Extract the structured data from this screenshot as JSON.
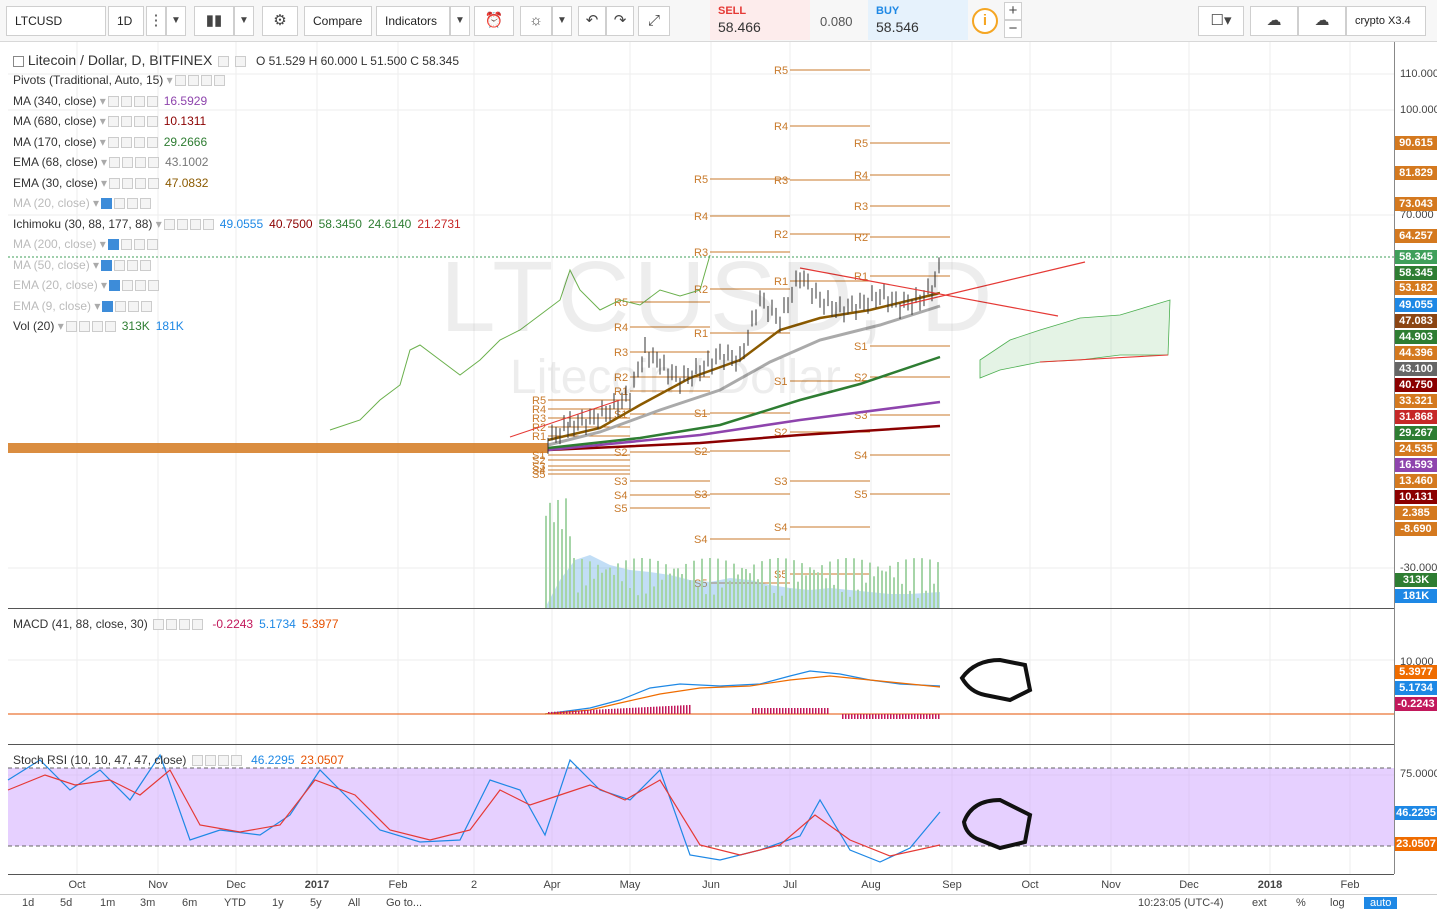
{
  "toolbar": {
    "symbol": "LTCUSD",
    "interval": "1D",
    "compare": "Compare",
    "indicators": "Indicators",
    "sell_label": "SELL",
    "sell_price": "58.466",
    "spread": "0.080",
    "buy_label": "BUY",
    "buy_price": "58.546",
    "layout_name": "crypto X3.4"
  },
  "main_legend": {
    "title": "Litecoin / Dollar, D, BITFINEX",
    "ohlc": "O 51.529  H 60.000  L 51.500  C 58.345",
    "rows": [
      {
        "name": "Pivots (Traditional, Auto, 15)",
        "value": "",
        "color": "#333",
        "hidden": false
      },
      {
        "name": "MA (340, close)",
        "value": "16.5929",
        "color": "#8e44ad",
        "hidden": false
      },
      {
        "name": "MA (680, close)",
        "value": "10.1311",
        "color": "#8b0000",
        "hidden": false
      },
      {
        "name": "MA (170, close)",
        "value": "29.2666",
        "color": "#2e7d32",
        "hidden": false
      },
      {
        "name": "EMA (68, close)",
        "value": "43.1002",
        "color": "#777",
        "hidden": false
      },
      {
        "name": "EMA (30, close)",
        "value": "47.0832",
        "color": "#8b5a00",
        "hidden": false
      },
      {
        "name": "MA (20, close)",
        "value": "",
        "color": "#bbb",
        "hidden": true
      },
      {
        "name": "Ichimoku (30, 88, 177, 88)",
        "value": "",
        "color": "#333",
        "hidden": false
      },
      {
        "name": "MA (200, close)",
        "value": "",
        "color": "#bbb",
        "hidden": true
      },
      {
        "name": "MA (50, close)",
        "value": "",
        "color": "#bbb",
        "hidden": true
      },
      {
        "name": "EMA (20, close)",
        "value": "",
        "color": "#bbb",
        "hidden": true
      },
      {
        "name": "EMA (9, close)",
        "value": "",
        "color": "#bbb",
        "hidden": true
      },
      {
        "name": "Vol (20)",
        "value": "",
        "color": "#333",
        "hidden": false
      }
    ],
    "ichimoku_values": [
      {
        "v": "49.0555",
        "color": "#1e88e5"
      },
      {
        "v": "40.7500",
        "color": "#8b0000"
      },
      {
        "v": "58.3450",
        "color": "#2e7d32"
      },
      {
        "v": "24.6140",
        "color": "#2e7d32"
      },
      {
        "v": "21.2731",
        "color": "#c62828"
      }
    ],
    "vol_values": [
      {
        "v": "313K",
        "color": "#2e7d32"
      },
      {
        "v": "181K",
        "color": "#1e88e5"
      }
    ]
  },
  "watermark": {
    "symbol": "LTCUSD, D",
    "name": "Litecoin / Dollar"
  },
  "price_axis": {
    "ticks": [
      "110.000",
      "100.000",
      "70.000",
      "-30.000"
    ],
    "labels": [
      {
        "v": "90.615",
        "color": "#d4791f"
      },
      {
        "v": "81.829",
        "color": "#d4791f"
      },
      {
        "v": "73.043",
        "color": "#d4791f"
      },
      {
        "v": "64.257",
        "color": "#d4791f"
      },
      {
        "v": "58.345",
        "color": "#3f9f5a"
      },
      {
        "v": "58.345",
        "color": "#2e7d32"
      },
      {
        "v": "53.182",
        "color": "#d4791f"
      },
      {
        "v": "49.055",
        "color": "#1e88e5"
      },
      {
        "v": "47.083",
        "color": "#8b4513"
      },
      {
        "v": "44.903",
        "color": "#2e7d32"
      },
      {
        "v": "44.396",
        "color": "#d4791f"
      },
      {
        "v": "43.100",
        "color": "#666666"
      },
      {
        "v": "40.750",
        "color": "#8b0000"
      },
      {
        "v": "33.321",
        "color": "#d4791f"
      },
      {
        "v": "31.868",
        "color": "#c62828"
      },
      {
        "v": "29.267",
        "color": "#2e7d32"
      },
      {
        "v": "24.535",
        "color": "#d4791f"
      },
      {
        "v": "16.593",
        "color": "#8e44ad"
      },
      {
        "v": "13.460",
        "color": "#d4791f"
      },
      {
        "v": "10.131",
        "color": "#8b0000"
      },
      {
        "v": "2.385",
        "color": "#d4791f"
      },
      {
        "v": "-8.690",
        "color": "#d4791f"
      },
      {
        "v": "313K",
        "color": "#2e7d32"
      },
      {
        "v": "181K",
        "color": "#1e88e5"
      }
    ]
  },
  "macd": {
    "name": "MACD (41, 88, close, 30)",
    "values": [
      {
        "v": "-0.2243",
        "color": "#c2185b"
      },
      {
        "v": "5.1734",
        "color": "#1e88e5"
      },
      {
        "v": "5.3977",
        "color": "#e65100"
      }
    ],
    "axis_tick": "10.000",
    "labels": [
      {
        "v": "5.3977",
        "color": "#ef6c00"
      },
      {
        "v": "5.1734",
        "color": "#1e88e5"
      },
      {
        "v": "-0.2243",
        "color": "#c2185b"
      }
    ]
  },
  "stoch": {
    "name": "Stoch RSI (10, 10, 47, 47, close)",
    "values": [
      {
        "v": "46.2295",
        "color": "#1e88e5"
      },
      {
        "v": "23.0507",
        "color": "#e65100"
      }
    ],
    "axis_tick": "75.0000",
    "labels": [
      {
        "v": "46.2295",
        "color": "#1e88e5"
      },
      {
        "v": "23.0507",
        "color": "#ef6c00"
      }
    ]
  },
  "time_axis": [
    "Oct",
    "Nov",
    "Dec",
    "2017",
    "Feb",
    "2",
    "Apr",
    "May",
    "Jun",
    "Jul",
    "Aug",
    "Sep",
    "Oct",
    "Nov",
    "Dec",
    "2018",
    "Feb"
  ],
  "bottom": {
    "ranges": [
      "1d",
      "5d",
      "1m",
      "3m",
      "6m",
      "YTD",
      "1y",
      "5y",
      "All"
    ],
    "goto": "Go to...",
    "clock": "10:23:05 (UTC-4)",
    "ext": "ext",
    "pct": "%",
    "log": "log",
    "auto": "auto"
  },
  "pivot_labels": {
    "set_a": [
      "R5",
      "R4",
      "R3",
      "R2",
      "R1",
      "P",
      "S1",
      "S2",
      "S3",
      "S4",
      "S5"
    ]
  }
}
